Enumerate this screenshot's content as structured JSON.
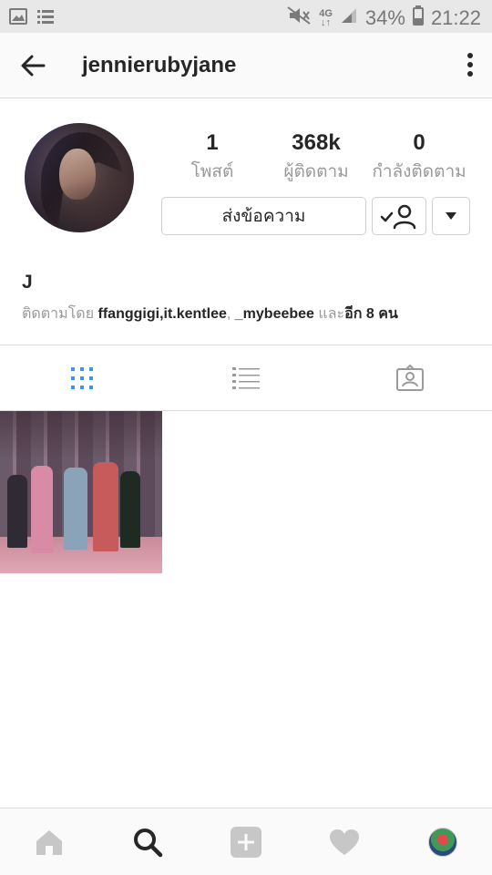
{
  "status_bar": {
    "battery": "34%",
    "time": "21:22",
    "network": "4G"
  },
  "header": {
    "username": "jennierubyjane"
  },
  "profile": {
    "stats": [
      {
        "value": "1",
        "label": "โพสต์"
      },
      {
        "value": "368k",
        "label": "ผู้ติดตาม"
      },
      {
        "value": "0",
        "label": "กำลังติดตาม"
      }
    ],
    "message_button": "ส่งข้อความ",
    "name": "J",
    "followed_by": {
      "prefix": "ติดตามโดย",
      "user1": "ffanggigi",
      "sep1": ",",
      "user2": "it.kentlee",
      "sep2": ",",
      "user3": "_mybeebee",
      "conj": "และ",
      "others": "อีก 8 คน"
    }
  },
  "tabs": [
    "grid-view",
    "list-view",
    "tagged-photos"
  ],
  "colors": {
    "accent": "#3897f0",
    "muted": "#999999",
    "border": "#dbdbdb"
  }
}
